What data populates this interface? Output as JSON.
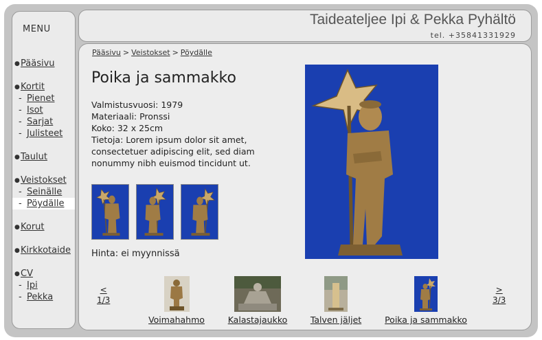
{
  "header": {
    "title": "Taideateljee Ipi & Pekka Pyhältö",
    "phone": "tel. +35841331929"
  },
  "sidebar": {
    "menu_title": "MENU",
    "groups": [
      {
        "items": [
          {
            "label": "Pääsivu",
            "level": 0
          }
        ]
      },
      {
        "items": [
          {
            "label": "Kortit",
            "level": 0
          },
          {
            "label": "Pienet",
            "level": 1
          },
          {
            "label": "Isot",
            "level": 1
          },
          {
            "label": "Sarjat",
            "level": 1
          },
          {
            "label": "Julisteet",
            "level": 1
          }
        ]
      },
      {
        "items": [
          {
            "label": "Taulut",
            "level": 0
          }
        ]
      },
      {
        "items": [
          {
            "label": "Veistokset",
            "level": 0
          },
          {
            "label": "Seinälle",
            "level": 1
          },
          {
            "label": "Pöydälle",
            "level": 1,
            "active": true
          }
        ]
      },
      {
        "items": [
          {
            "label": "Korut",
            "level": 0
          }
        ]
      },
      {
        "items": [
          {
            "label": "Kirkkotaide",
            "level": 0
          }
        ]
      },
      {
        "items": [
          {
            "label": "CV",
            "level": 0
          },
          {
            "label": "Ipi",
            "level": 1
          },
          {
            "label": "Pekka",
            "level": 1
          }
        ]
      }
    ]
  },
  "breadcrumb": [
    "Pääsivu",
    "Veistokset",
    "Pöydälle"
  ],
  "artwork": {
    "title": "Poika ja sammakko",
    "year": "Valmistusvuosi: 1979",
    "material": "Materiaali: Pronssi",
    "size": "Koko: 32 x 25cm",
    "info": "Tietoja: Lorem ipsum dolor sit amet, consectetuer adipiscing elit, sed diam nonummy nibh euismod tincidunt ut.",
    "price": "Hinta: ei myynnissä"
  },
  "pager": {
    "prev_arrow": "<",
    "prev_page": "1/3",
    "next_arrow": ">",
    "next_page": "3/3"
  },
  "strip": [
    {
      "label": "Voimahahmo"
    },
    {
      "label": "Kalastajaukko"
    },
    {
      "label": "Talven jäljet"
    },
    {
      "label": "Poika ja sammakko"
    }
  ],
  "colors": {
    "frame": "#c4c4c4",
    "panel": "#ebebeb",
    "photo_background": "#1a3fb0",
    "bronze": "#a07c45"
  },
  "icons": {
    "bullet": "●"
  }
}
